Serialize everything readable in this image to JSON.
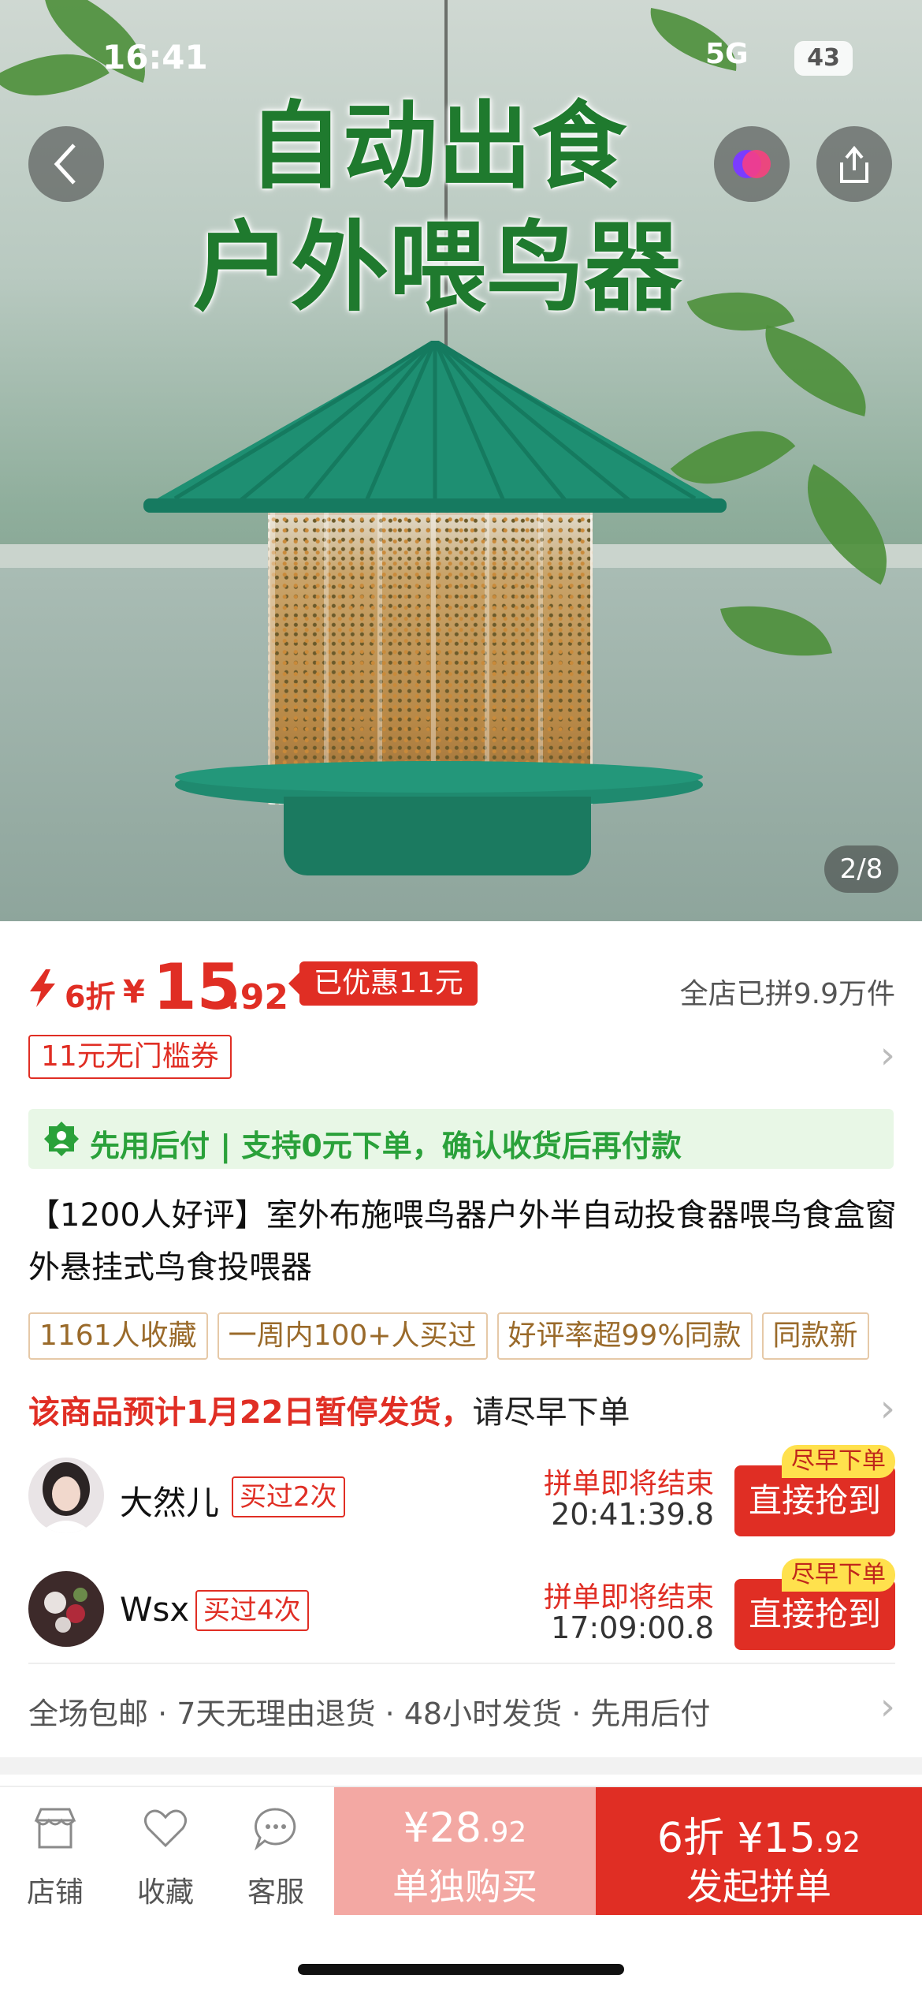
{
  "status": {
    "time": "16:41",
    "network": "5G",
    "battery": "43"
  },
  "hero": {
    "title_line1": "自动出食",
    "title_line2": "户外喂鸟器",
    "counter": "2/8"
  },
  "price": {
    "discount": "6折",
    "currency": "¥",
    "integer": "15",
    "decimal": ".92",
    "saving": "已优惠11元",
    "sold": "全店已拼9.9万件"
  },
  "coupon": {
    "label": "11元无门槛券"
  },
  "pay_after": {
    "text": "先用后付 | 支持0元下单，确认收货后再付款"
  },
  "product_title": "【1200人好评】室外布施喂鸟器户外半自动投食器喂鸟食盒窗外悬挂式鸟食投喂器",
  "tags": [
    "1161人收藏",
    "一周内100+人买过",
    "好评率超99%同款",
    "同款新"
  ],
  "notice": {
    "red": "该商品预计1月22日暂停发货，",
    "normal": "请尽早下单"
  },
  "groups": [
    {
      "name": "大然儿",
      "bought": "买过2次",
      "ending": "拼单即将结束",
      "countdown": "20:41:39.8",
      "button": "直接抢到",
      "hurry": "尽早下单"
    },
    {
      "name": "Wsx",
      "bought": "买过4次",
      "ending": "拼单即将结束",
      "countdown": "17:09:00.8",
      "button": "直接抢到",
      "hurry": "尽早下单"
    }
  ],
  "services": [
    "全场包邮",
    "7天无理由退货",
    "48小时发货",
    "先用后付"
  ],
  "bottom": {
    "store": "店铺",
    "favorite": "收藏",
    "service": "客服",
    "solo_price": "¥28",
    "solo_price_dec": ".92",
    "solo_label": "单独购买",
    "group_price": "6折 ¥15",
    "group_price_dec": ".92",
    "group_label": "发起拼单"
  },
  "colors": {
    "accent": "#e02e24",
    "green": "#2aa13a",
    "solo_bg": "#f3a8a3"
  }
}
